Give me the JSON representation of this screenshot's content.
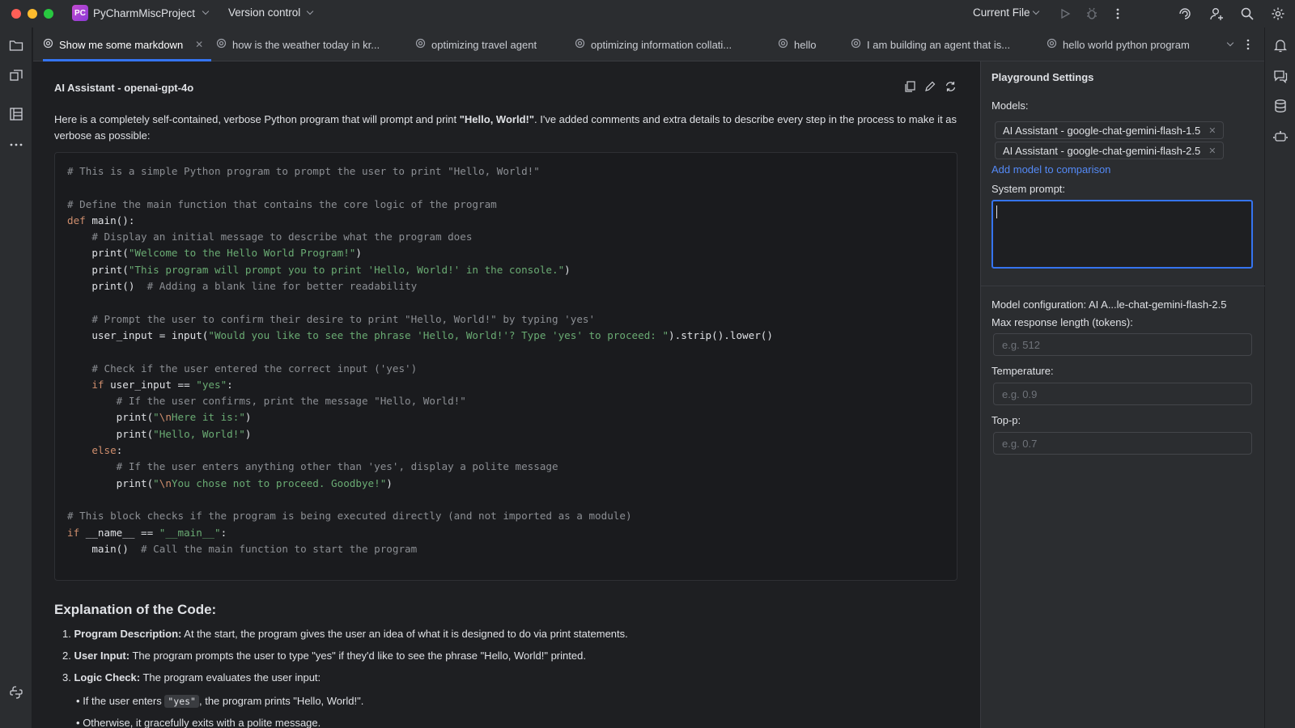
{
  "titlebar": {
    "project_badge": "PC",
    "project_name": "PyCharmMiscProject",
    "version_control": "Version control",
    "current_file": "Current File",
    "colors": {
      "close": "#ff5f57",
      "minimize": "#febc2e",
      "zoom": "#28c840",
      "accent": "#3574f0"
    }
  },
  "tabs": [
    {
      "label": "Show me some markdown",
      "active": true
    },
    {
      "label": "how is the weather today in kr..."
    },
    {
      "label": "optimizing travel agent"
    },
    {
      "label": "optimizing information collati..."
    },
    {
      "label": "hello"
    },
    {
      "label": "I am building an agent that is..."
    },
    {
      "label": "hello world python program"
    }
  ],
  "chat": {
    "title": "AI Assistant - openai-gpt-4o",
    "intro_prefix": "Here is a completely self-contained, verbose Python program that will prompt and print ",
    "intro_bold": "\"Hello, World!\"",
    "intro_suffix": ". I've added comments and extra details to describe every step in the process to make it as verbose as possible:",
    "code_lines": [
      "# This is a simple Python program to prompt the user to print \"Hello, World!\"",
      "",
      "# Define the main function that contains the core logic of the program",
      "def main():",
      "    # Display an initial message to describe what the program does",
      "    print(\"Welcome to the Hello World Program!\")",
      "    print(\"This program will prompt you to print 'Hello, World!' in the console.\")",
      "    print()  # Adding a blank line for better readability",
      "",
      "    # Prompt the user to confirm their desire to print \"Hello, World!\" by typing 'yes'",
      "    user_input = input(\"Would you like to see the phrase 'Hello, World!'? Type 'yes' to proceed: \").strip().lower()",
      "",
      "    # Check if the user entered the correct input ('yes')",
      "    if user_input == \"yes\":",
      "        # If the user confirms, print the message \"Hello, World!\"",
      "        print(\"\\nHere it is:\")",
      "        print(\"Hello, World!\")",
      "    else:",
      "        # If the user enters anything other than 'yes', display a polite message",
      "        print(\"\\nYou chose not to proceed. Goodbye!\")",
      "",
      "# This block checks if the program is being executed directly (and not imported as a module)",
      "if __name__ == \"__main__\":",
      "    main()  # Call the main function to start the program"
    ],
    "explanation_title": "Explanation of the Code:",
    "items": [
      {
        "num": "1.",
        "bold": "Program Description:",
        "text": " At the start, the program gives the user an idea of what it is designed to do via print statements."
      },
      {
        "num": "2.",
        "bold": "User Input:",
        "text": " The program prompts the user to type \"yes\" if they'd like to see the phrase \"Hello, World!\" printed."
      },
      {
        "num": "3.",
        "bold": "Logic Check:",
        "text": " The program evaluates the user input:"
      }
    ],
    "sub1_prefix": "If the user enters ",
    "sub1_code": "\"yes\"",
    "sub1_suffix": ", the program prints \"Hello, World!\".",
    "sub2": "Otherwise, it gracefully exits with a polite message."
  },
  "settings": {
    "title": "Playground Settings",
    "models_label": "Models:",
    "models": [
      "AI Assistant - google-chat-gemini-flash-1.5",
      "AI Assistant - google-chat-gemini-flash-2.5"
    ],
    "add_model": "Add model to comparison",
    "system_prompt_label": "System prompt:",
    "system_prompt_value": "",
    "model_config": "Model configuration: AI A...le-chat-gemini-flash-2.5",
    "max_len_label": "Max response length (tokens):",
    "max_len_placeholder": "e.g. 512",
    "temperature_label": "Temperature:",
    "temperature_placeholder": "e.g. 0.9",
    "top_p_label": "Top-p:",
    "top_p_placeholder": "e.g. 0.7"
  }
}
